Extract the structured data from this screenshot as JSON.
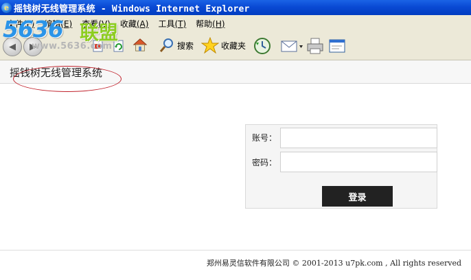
{
  "window": {
    "title": "摇钱树无线管理系统 - Windows Internet Explorer",
    "icon": "ie-icon"
  },
  "menubar": {
    "items": [
      {
        "label": "文件",
        "accel": "(F)"
      },
      {
        "label": "编辑",
        "accel": "(E)"
      },
      {
        "label": "查看",
        "accel": "(V)"
      },
      {
        "label": "收藏",
        "accel": "(A)"
      },
      {
        "label": "工具",
        "accel": "(T)"
      },
      {
        "label": "帮助",
        "accel": "(H)"
      }
    ]
  },
  "toolbar": {
    "search_label": "搜索",
    "favorites_label": "收藏夹",
    "icons": [
      "back-icon",
      "forward-icon",
      "stop-icon",
      "refresh-icon",
      "home-icon",
      "search-icon",
      "favorites-star-icon",
      "history-icon",
      "mail-icon",
      "print-icon",
      "edit-icon"
    ]
  },
  "watermark": {
    "brand_number": "5636",
    "brand_text": "联盟",
    "url": "www.5636.com"
  },
  "page": {
    "title": "摇钱树无线管理系统"
  },
  "login": {
    "account_label": "账号：",
    "account_value": "",
    "password_label": "密码：",
    "password_value": "",
    "submit_label": "登录"
  },
  "footer": {
    "copyright": "郑州易灵信软件有限公司 © 2001-2013 u7pk.com , All rights reserved"
  },
  "colors": {
    "titlebar": "#0a4ad4",
    "chrome": "#ece9d8",
    "annotation": "#c0202a",
    "button": "#222222"
  }
}
